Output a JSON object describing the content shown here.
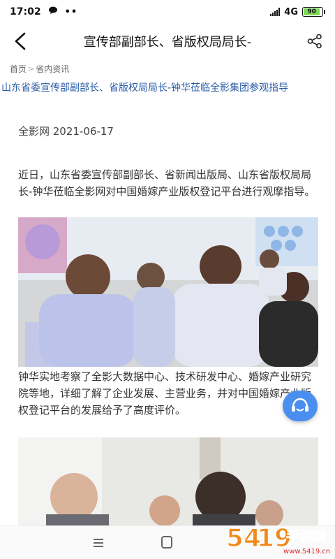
{
  "status_bar": {
    "time": "17:02",
    "network": "4G",
    "battery": "90"
  },
  "nav": {
    "title": "宣传部副部长、省版权局局长-"
  },
  "breadcrumb": {
    "home": "首页",
    "section": "省内资讯"
  },
  "article": {
    "title": "山东省委宣传部副部长、省版权局局长-钟华莅临全影集团参观指导",
    "source_date": "全影网 2021-06-17",
    "paragraph1": "近日，山东省委宣传部副部长、省新闻出版局、山东省版权局局长-钟华莅临全影网对中国婚嫁产业版权登记平台进行观摩指导。",
    "paragraph2": "钟华实地考察了全影大数据中心、技术研发中心、婚嫁产业研究院等地，详细了解了企业发展、主营业务，并对中国婚嫁产业版权登记平台的发展给予了高度评价。"
  },
  "watermark": {
    "logo_text": "5419手游网",
    "url": "www.5419.cn"
  },
  "colors": {
    "title_blue": "#2a5ca8",
    "chat_button": "#4a8ff0",
    "battery_green": "#7ed957"
  }
}
